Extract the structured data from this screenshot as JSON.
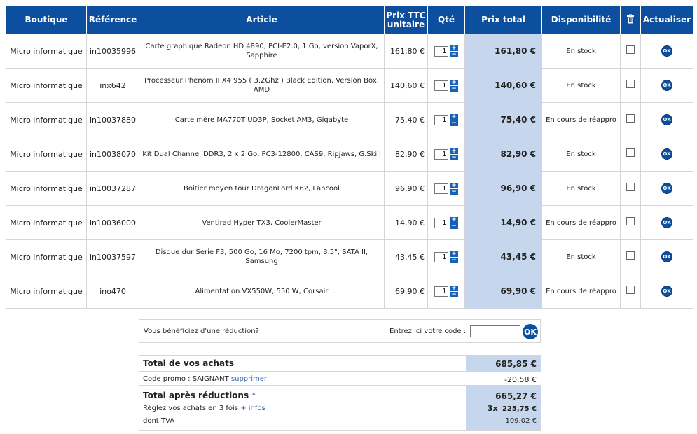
{
  "headers": {
    "shop": "Boutique",
    "ref": "Référence",
    "article": "Article",
    "unit_price": "Prix TTC unitaire",
    "qty": "Qté",
    "total": "Prix total",
    "availability": "Disponibilité",
    "update": "Actualiser"
  },
  "rows": [
    {
      "shop": "Micro informatique",
      "ref": "in10035996",
      "article": "Carte graphique Radeon HD 4890, PCI-E2.0, 1 Go, version VaporX, Sapphire",
      "unit": "161,80 €",
      "qty": "1",
      "total": "161,80 €",
      "avail": "En stock"
    },
    {
      "shop": "Micro informatique",
      "ref": "inx642",
      "article": "Processeur Phenom II X4 955 ( 3.2Ghz ) Black Edition, Version Box, AMD",
      "unit": "140,60 €",
      "qty": "1",
      "total": "140,60 €",
      "avail": "En stock"
    },
    {
      "shop": "Micro informatique",
      "ref": "in10037880",
      "article": "Carte mère MA770T UD3P, Socket AM3, Gigabyte",
      "unit": "75,40 €",
      "qty": "1",
      "total": "75,40 €",
      "avail": "En cours de réappro"
    },
    {
      "shop": "Micro informatique",
      "ref": "in10038070",
      "article": "Kit Dual Channel DDR3, 2 x 2 Go, PC3-12800, CAS9, Ripjaws, G.Skill",
      "unit": "82,90 €",
      "qty": "1",
      "total": "82,90 €",
      "avail": "En stock"
    },
    {
      "shop": "Micro informatique",
      "ref": "in10037287",
      "article": "Boîtier moyen tour DragonLord K62, Lancool",
      "unit": "96,90 €",
      "qty": "1",
      "total": "96,90 €",
      "avail": "En stock"
    },
    {
      "shop": "Micro informatique",
      "ref": "in10036000",
      "article": "Ventirad Hyper TX3, CoolerMaster",
      "unit": "14,90 €",
      "qty": "1",
      "total": "14,90 €",
      "avail": "En cours de réappro"
    },
    {
      "shop": "Micro informatique",
      "ref": "in10037597",
      "article": "Disque dur Serie F3, 500 Go, 16 Mo, 7200 tpm, 3.5\", SATA II, Samsung",
      "unit": "43,45 €",
      "qty": "1",
      "total": "43,45 €",
      "avail": "En stock"
    },
    {
      "shop": "Micro informatique",
      "ref": "ino470",
      "article": "Alimentation VX550W, 550 W, Corsair",
      "unit": "69,90 €",
      "qty": "1",
      "total": "69,90 €",
      "avail": "En cours de réappro"
    }
  ],
  "buttons": {
    "ok": "OK",
    "plus": "+",
    "minus": "−"
  },
  "icons": {
    "trash": "trash-icon"
  },
  "promo": {
    "question": "Vous bénéficiez d'une réduction?",
    "label": "Entrez ici votre code :",
    "value": ""
  },
  "summary": {
    "total_label": "Total de vos achats",
    "total_value": "685,85 €",
    "code_prefix": "Code promo : SAIGNANT",
    "code_remove": "supprimer",
    "code_value": "-20,58 €",
    "after_label": "Total après réductions",
    "after_star": "*",
    "after_value": "665,27 €",
    "installments_text": "Réglez vos achats en 3 fois",
    "installments_link": "+ infos",
    "installments_count": "3x",
    "installments_value": "225,75 €",
    "vat_label": "dont TVA",
    "vat_value": "109,02 €"
  },
  "colors": {
    "header": "#0c4f9e",
    "total_col": "#c6d6ec",
    "link": "#2f64b2"
  }
}
